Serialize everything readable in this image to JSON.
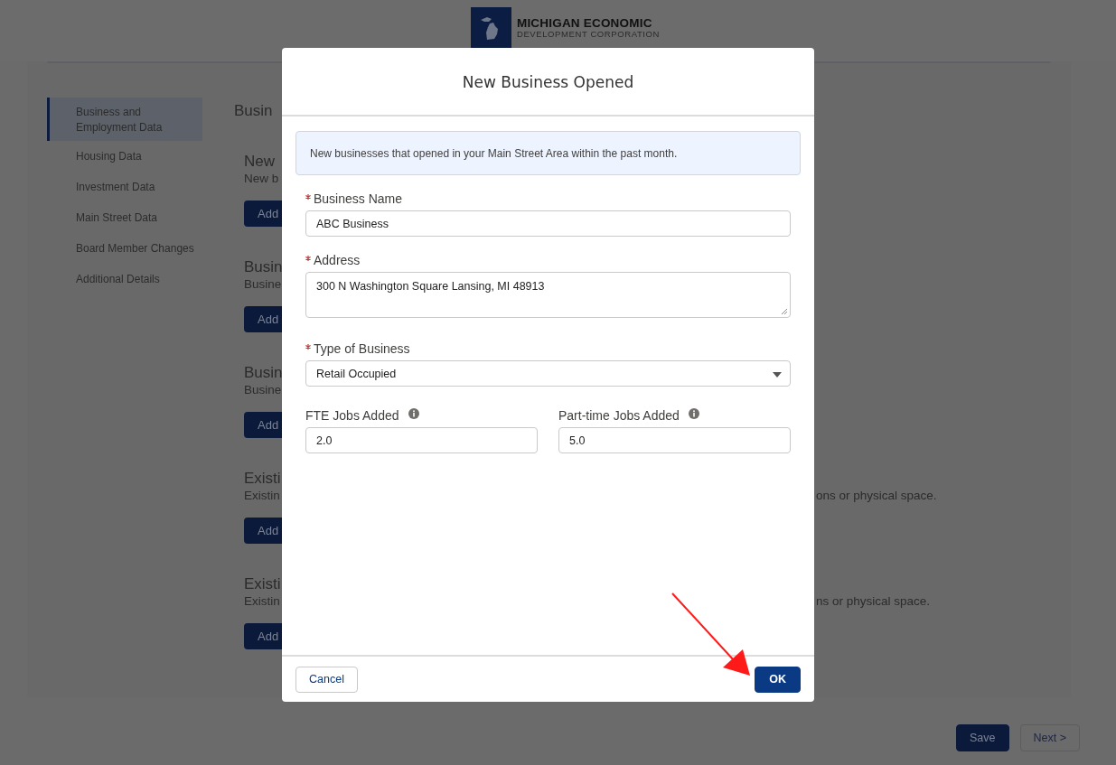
{
  "header": {
    "logo_title": "MICHIGAN ECONOMIC",
    "logo_subtitle": "DEVELOPMENT CORPORATION"
  },
  "sidebar": {
    "items": [
      {
        "label": "Business and Employment Data",
        "selected": true
      },
      {
        "label": "Housing Data",
        "selected": false
      },
      {
        "label": "Investment Data",
        "selected": false
      },
      {
        "label": "Main Street Data",
        "selected": false
      },
      {
        "label": "Board Member Changes",
        "selected": false
      },
      {
        "label": "Additional Details",
        "selected": false
      }
    ]
  },
  "content": {
    "heading": "Busin",
    "sections": [
      {
        "title": "New",
        "description": "New b",
        "button": "Add"
      },
      {
        "title": "Busin",
        "description": "Busine",
        "button": "Add"
      },
      {
        "title": "Busin",
        "description": "Busine",
        "button": "Add"
      },
      {
        "title": "Existi",
        "description": "Existin",
        "description_end": "ons or physical space.",
        "button": "Add"
      },
      {
        "title": "Existi",
        "description": "Existin",
        "description_end": "ns or physical space.",
        "button": "Add"
      }
    ]
  },
  "footer": {
    "buttons": [
      {
        "label": "Save",
        "kind": "primary"
      },
      {
        "label": "Next >",
        "kind": "neutral"
      }
    ]
  },
  "modal": {
    "title": "New Business Opened",
    "info": "New businesses that opened in your Main Street Area within the past month.",
    "fields": [
      {
        "kind": "text",
        "label": "Business Name",
        "required": true,
        "value": "ABC Business"
      },
      {
        "kind": "textarea",
        "label": "Address",
        "required": true,
        "value": "300 N Washington Square Lansing, MI 48913"
      },
      {
        "kind": "select",
        "label": "Type of Business",
        "required": true,
        "value": "Retail Occupied"
      }
    ],
    "job_fields": [
      {
        "label": "FTE Jobs Added",
        "info": true,
        "value": "2.0"
      },
      {
        "label": "Part-time Jobs Added",
        "info": true,
        "value": "5.0"
      }
    ],
    "buttons": [
      {
        "label": "Cancel",
        "kind": "neutral"
      },
      {
        "label": "OK",
        "kind": "brand"
      }
    ]
  }
}
